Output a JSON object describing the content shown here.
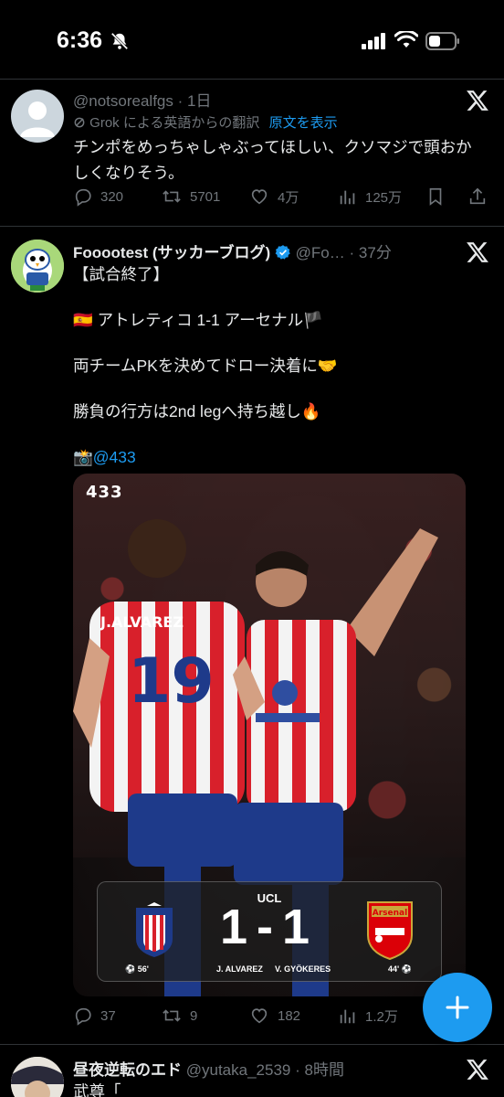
{
  "status": {
    "time": "6:36"
  },
  "tweet1": {
    "handle": "@notsorealfgs",
    "sep": "·",
    "time": "1日",
    "translate_note": "Grok による英語からの翻訳",
    "show_original": "原文を表示",
    "text_line1": "チンポをめっちゃしゃぶってほしい、クソマジで頭おか",
    "text_line2": "しくなりそう。",
    "replies": "320",
    "retweets": "5701",
    "likes": "4万",
    "views": "125万"
  },
  "tweet2": {
    "name": "Fooootest (サッカーブログ)",
    "handle": "@Fo…",
    "sep": "·",
    "time": "37分",
    "line1": "【試合終了】",
    "line2_flag_left": "🇪🇸",
    "line2": " アトレティコ 1-1 アーセナル",
    "line2_flag_right": "🏴",
    "line3": "両チームPKを決めてドロー決着に🤝",
    "line4": "勝負の行方は2nd legへ持ち越し🔥",
    "line5_emoji": "📸",
    "line5_link": "@433",
    "media": {
      "watermark": "433",
      "competition": "UCL",
      "score_home": "1",
      "score_sep": "-",
      "score_away": "1",
      "home_minute": "56'",
      "home_scorer": "J. ALVAREZ",
      "away_scorer": "V. GYÖKERES",
      "away_minute": "44'",
      "away_crest_text": "Arsenal"
    },
    "replies": "37",
    "retweets": "9",
    "likes": "182",
    "views": "1.2万"
  },
  "tweet3": {
    "name": "昼夜逆転のエド",
    "handle": "@yutaka_2539",
    "sep": "·",
    "time": "8時間",
    "text": "武尊「"
  },
  "colors": {
    "accent": "#1d9bf0",
    "muted": "#71767b",
    "text": "#e7e9ea",
    "background": "#000000"
  }
}
